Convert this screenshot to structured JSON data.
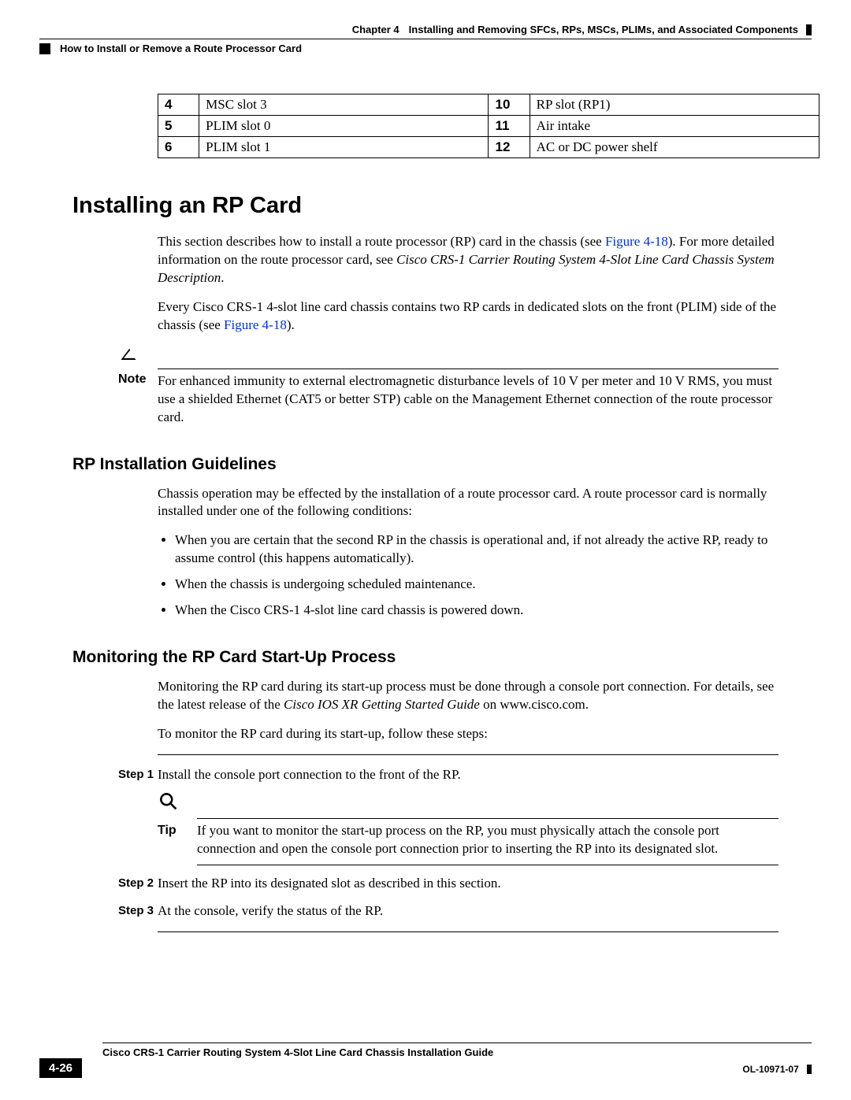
{
  "header": {
    "chapter_label": "Chapter 4",
    "chapter_title": "Installing and Removing SFCs, RPs, MSCs, PLIMs, and Associated Components",
    "subheader": "How to Install or Remove a Route Processor Card"
  },
  "table": {
    "rows": [
      {
        "n1": "4",
        "d1": "MSC slot 3",
        "n2": "10",
        "d2": "RP slot (RP1)"
      },
      {
        "n1": "5",
        "d1": "PLIM slot 0",
        "n2": "11",
        "d2": "Air intake"
      },
      {
        "n1": "6",
        "d1": "PLIM slot 1",
        "n2": "12",
        "d2": "AC or DC power shelf"
      }
    ]
  },
  "section1": {
    "title": "Installing an RP Card",
    "p1a": "This section describes how to install a route processor (RP) card in the chassis (see ",
    "p1_link1": "Figure 4-18",
    "p1b": "). For more detailed information on the route processor card, see ",
    "p1_italic": "Cisco CRS-1 Carrier Routing System 4-Slot Line Card Chassis System Description",
    "p1c": ".",
    "p2a": "Every Cisco CRS-1 4-slot line card chassis contains two RP cards in dedicated slots on the front (PLIM) side of the chassis (see ",
    "p2_link1": "Figure 4-18",
    "p2b": ")."
  },
  "note": {
    "label": "Note",
    "text": "For enhanced immunity to external electromagnetic disturbance levels of 10 V per meter and 10 V RMS, you must use a shielded Ethernet (CAT5 or better STP) cable on the Management Ethernet connection of the route processor card."
  },
  "section2": {
    "title": "RP Installation Guidelines",
    "intro": "Chassis operation may be effected by the installation of a route processor card. A route processor card is normally installed under one of the following conditions:",
    "bullets": [
      "When you are certain that the second RP in the chassis is operational and, if not already the active RP, ready to assume control (this happens automatically).",
      "When the chassis is undergoing scheduled maintenance.",
      "When the Cisco CRS-1 4-slot line card chassis is powered down."
    ]
  },
  "section3": {
    "title": "Monitoring the RP Card Start-Up Process",
    "p1a": "Monitoring the RP card during its start-up process must be done through a console port connection. For details, see the latest release of the ",
    "p1_italic": "Cisco IOS XR Getting Started Guide",
    "p1b": " on www.cisco.com.",
    "p2": "To monitor the RP card during its start-up, follow these steps:"
  },
  "steps": {
    "s1_label": "Step 1",
    "s1_text": "Install the console port connection to the front of the RP.",
    "tip_label": "Tip",
    "tip_text": "If you want to monitor the start-up process on the RP, you must physically attach the console port connection and open the console port connection prior to inserting the RP into its designated slot.",
    "s2_label": "Step 2",
    "s2_text": "Insert the RP into its designated slot as described in this section.",
    "s3_label": "Step 3",
    "s3_text": "At the console, verify the status of the RP."
  },
  "footer": {
    "guide_title": "Cisco CRS-1 Carrier Routing System 4-Slot Line Card Chassis Installation Guide",
    "page_number": "4-26",
    "doc_id": "OL-10971-07"
  }
}
